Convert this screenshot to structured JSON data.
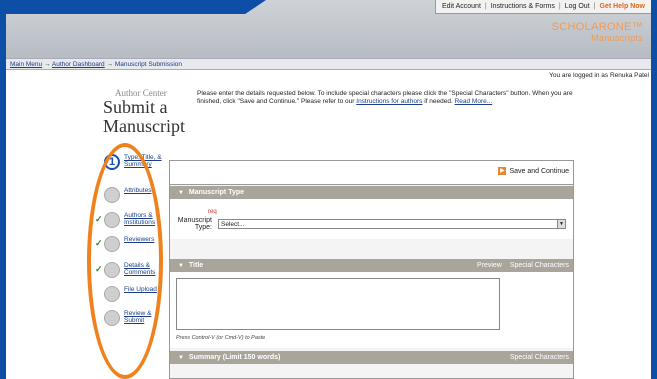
{
  "top_links": [
    "Edit Account",
    "Instructions & Forms",
    "Log Out",
    "Get Help Now"
  ],
  "brand": {
    "name": "SCHOLARONE™",
    "sub": "Manuscripts"
  },
  "breadcrumb": [
    "Main Menu",
    "Author Dashboard",
    "Manuscript Submission"
  ],
  "logged_in": "You are logged in as Renuka Patel",
  "author_center": {
    "small": "Author Center",
    "title_line1": "Submit a",
    "title_line2": "Manuscript"
  },
  "instructions": {
    "text": "Please enter the details requested below. To include special characters please click the \"Special Characters\" button. When you are finished, click \"Save and Continue.\" Please refer to our",
    "link1": "Instructions for authors",
    "text2": "if needed.",
    "link2": "Read More..."
  },
  "steps": [
    {
      "label": "Type, Title, & Summary",
      "number": "1",
      "active": true,
      "checked": false
    },
    {
      "label": "Attributes",
      "checked": false
    },
    {
      "label": "Authors & Institutions",
      "checked": true
    },
    {
      "label": "Reviewers",
      "checked": true
    },
    {
      "label": "Details & Comments",
      "checked": true
    },
    {
      "label": "File Upload",
      "checked": false
    },
    {
      "label": "Review & Submit",
      "checked": false
    }
  ],
  "save_continue": "Save and Continue",
  "manuscript_type": {
    "header": "Manuscript Type",
    "label": "Manuscript Type:",
    "required": "req",
    "select_value": "Select..."
  },
  "title_section": {
    "header": "Title",
    "preview": "Preview",
    "special_chars": "Special Characters",
    "hint": "Press Control-V (or Cmd-V) to Paste"
  },
  "summary_section": {
    "header": "Summary (Limit 150 words)",
    "special_chars": "Special Characters"
  },
  "colors": {
    "accent_orange": "#f0821e",
    "brand_blue": "#0d4ea6",
    "section_header": "#a9a59b"
  }
}
